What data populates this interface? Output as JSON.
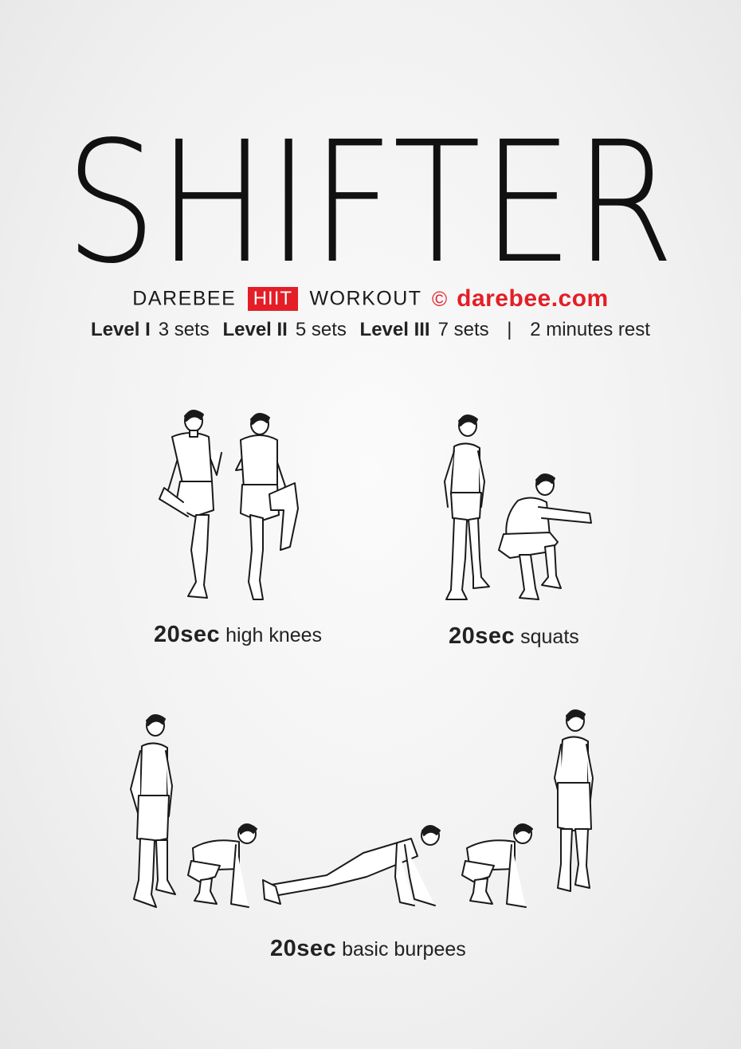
{
  "title": "SHIFTER",
  "brand": {
    "name": "DAREBEE",
    "tag": "HIIT",
    "type": "WORKOUT",
    "copyright_symbol": "©",
    "site": "darebee.com",
    "accent_color": "#e41e26"
  },
  "levels": [
    {
      "label": "Level I",
      "value": "3 sets"
    },
    {
      "label": "Level II",
      "value": "5 sets"
    },
    {
      "label": "Level III",
      "value": "7 sets"
    }
  ],
  "rest": "2 minutes rest",
  "separator": "|",
  "exercises": [
    {
      "duration": "20sec",
      "name": "high knees"
    },
    {
      "duration": "20sec",
      "name": "squats"
    },
    {
      "duration": "20sec",
      "name": "basic burpees"
    }
  ]
}
